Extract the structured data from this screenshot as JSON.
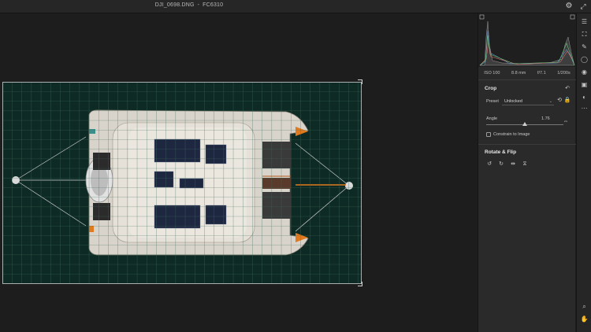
{
  "window": {
    "filename": "DJI_0698.DNG",
    "separator": "-",
    "camera": "FC6310",
    "settings_icon": "gear-icon",
    "expand_icon": "expand-icon"
  },
  "histogram": {
    "exif": {
      "iso": "ISO 100",
      "focal_length": "8.8 mm",
      "aperture": "f/7.1",
      "shutter": "1/200s"
    }
  },
  "crop": {
    "title": "Crop",
    "preset_label": "Preset",
    "preset_value": "Unlocked",
    "angle_label": "Angle",
    "angle_value": "1.76",
    "angle_fraction": 0.5,
    "constrain_label": "Constrain to Image",
    "constrain_checked": false
  },
  "rotate": {
    "title": "Rotate & Flip"
  },
  "tools": [
    "sliders-icon",
    "crop-icon",
    "healing-brush-icon",
    "mask-circle-icon",
    "red-eye-icon",
    "presets-icon",
    "versions-icon",
    "more-icon"
  ],
  "bottom_tools": [
    "zoom-icon",
    "hand-icon"
  ],
  "colors": {
    "grid": "#3d6d5f",
    "water": "#0e2a24",
    "accent_orange": "#e07a1f"
  }
}
